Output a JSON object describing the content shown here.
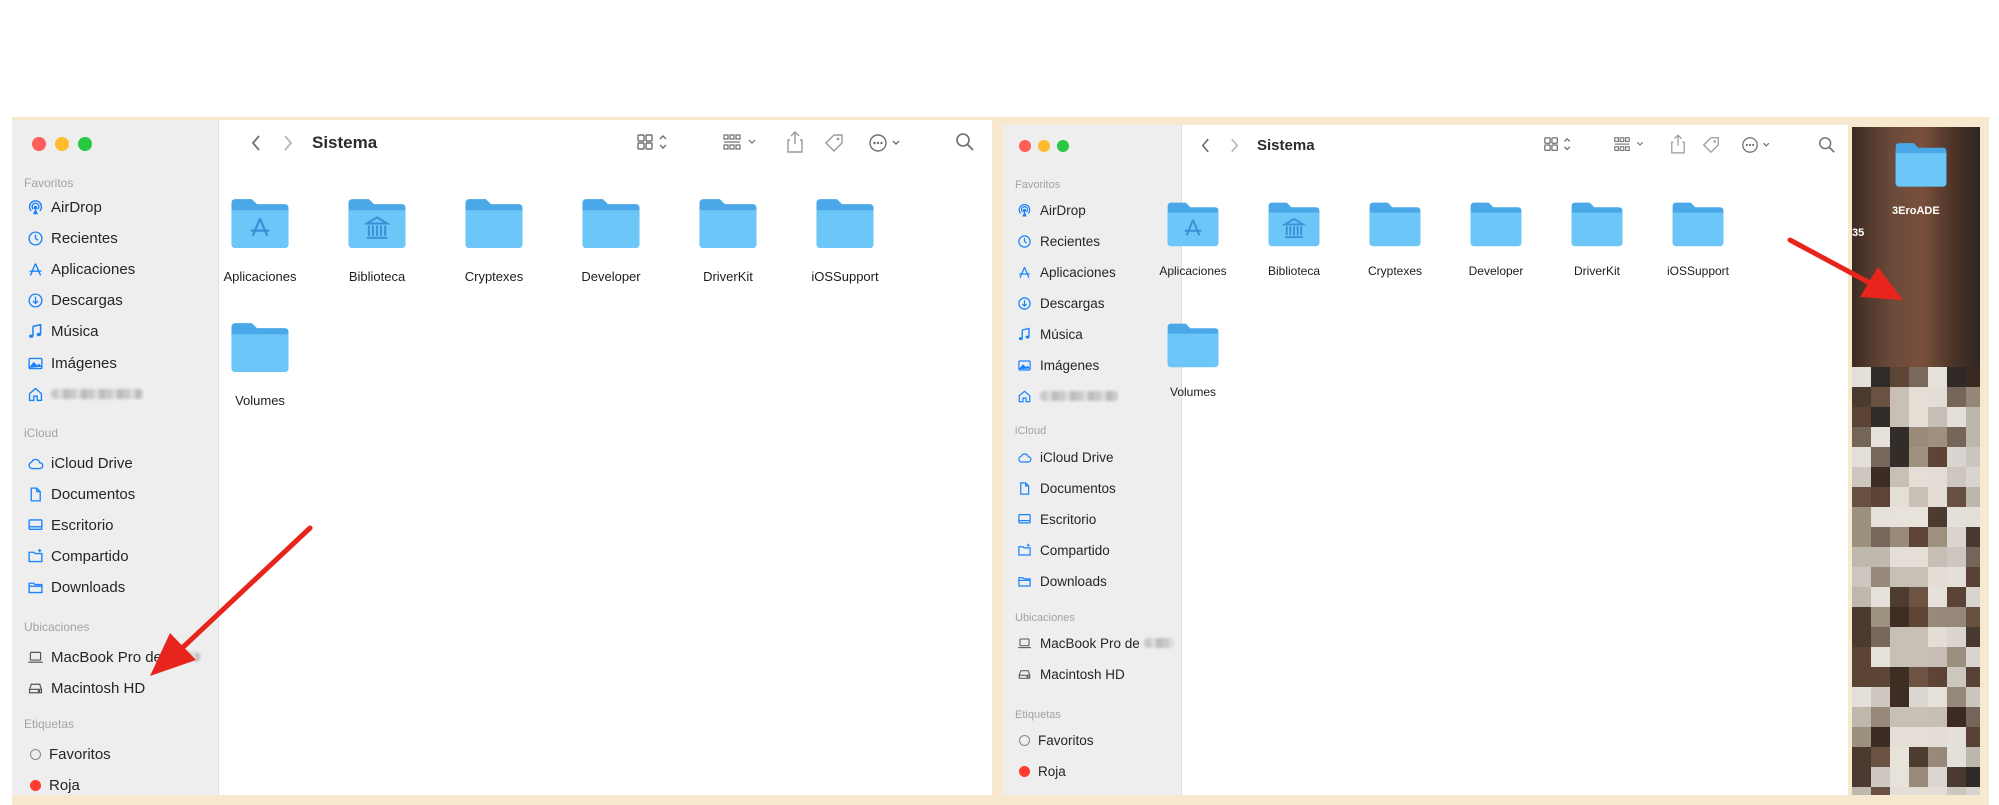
{
  "window": {
    "title": "Sistema",
    "folders": [
      {
        "label": "Aplicaciones",
        "glyph": "apps-glyph"
      },
      {
        "label": "Biblioteca",
        "glyph": "library-glyph"
      },
      {
        "label": "Cryptexes",
        "glyph": ""
      },
      {
        "label": "Developer",
        "glyph": ""
      },
      {
        "label": "DriverKit",
        "glyph": ""
      },
      {
        "label": "iOSSupport",
        "glyph": ""
      },
      {
        "label": "Volumes",
        "glyph": ""
      }
    ]
  },
  "sidebar": {
    "favorites_title": "Favoritos",
    "favorites": [
      {
        "label": "AirDrop",
        "icon": "airdrop-icon"
      },
      {
        "label": "Recientes",
        "icon": "clock-icon"
      },
      {
        "label": "Aplicaciones",
        "icon": "apps-icon"
      },
      {
        "label": "Descargas",
        "icon": "download-icon"
      },
      {
        "label": "Música",
        "icon": "music-icon"
      },
      {
        "label": "Imágenes",
        "icon": "photos-icon"
      }
    ],
    "icloud_title": "iCloud",
    "icloud": [
      {
        "label": "iCloud Drive",
        "icon": "cloud-icon"
      },
      {
        "label": "Documentos",
        "icon": "document-icon"
      },
      {
        "label": "Escritorio",
        "icon": "desktop-icon"
      },
      {
        "label": "Compartido",
        "icon": "shared-folder-icon"
      },
      {
        "label": "Downloads",
        "icon": "folder-icon"
      }
    ],
    "locations_title": "Ubicaciones",
    "locations": [
      {
        "label": "MacBook Pro de",
        "icon": "laptop-icon"
      },
      {
        "label": "Macintosh HD",
        "icon": "disk-icon"
      }
    ],
    "tags_title": "Etiquetas",
    "tags": [
      {
        "label": "Favoritos",
        "color": "#ffffff"
      },
      {
        "label": "Roja",
        "color": "#ff3b30"
      }
    ]
  },
  "desktop": {
    "folder_label": "3EroADE",
    "edge_text": "35"
  },
  "colors": {
    "accent": "#1a82fb",
    "folder": "#6cc6f7",
    "arrow": "#e8251c",
    "frame": "#f6e9cf"
  }
}
